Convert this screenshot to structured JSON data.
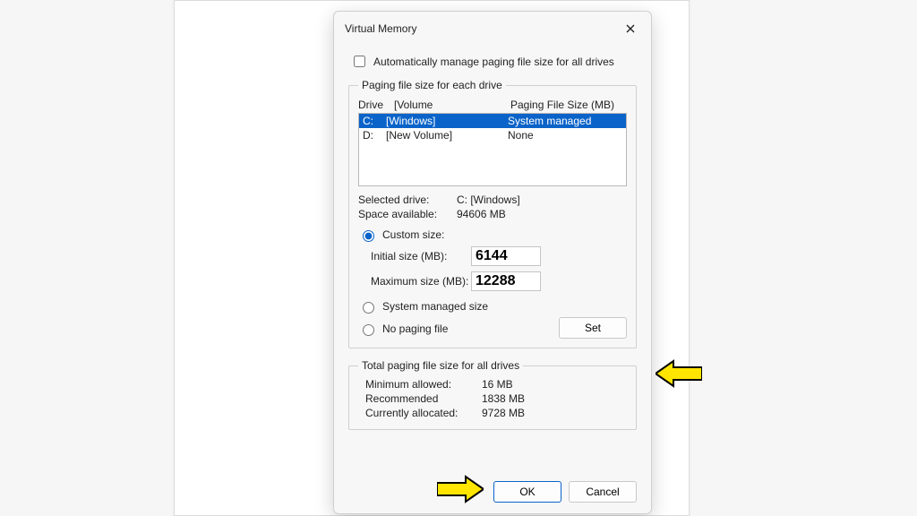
{
  "window": {
    "title": "Virtual Memory"
  },
  "auto": {
    "label": "Automatically manage paging file size for all drives"
  },
  "group1": {
    "legend": "Paging file size for each drive",
    "hdr_drive": "Drive",
    "hdr_volume": "[Volume",
    "hdr_size": "Paging File Size (MB)",
    "rows": [
      {
        "drive": "C:",
        "volume": "[Windows]",
        "size": "System managed"
      },
      {
        "drive": "D:",
        "volume": "[New Volume]",
        "size": "None"
      }
    ],
    "sel_label": "Selected drive:",
    "sel_value": "C:  [Windows]",
    "space_label": "Space available:",
    "space_value": "94606 MB",
    "custom_label": "Custom size:",
    "init_label": "Initial size (MB):",
    "init_value": "6144",
    "max_label": "Maximum size (MB):",
    "max_value": "12288",
    "sysman_label": "System managed size",
    "nopage_label": "No paging file",
    "set_label": "Set"
  },
  "group2": {
    "legend": "Total paging file size for all drives",
    "min_label": "Minimum allowed:",
    "min_value": "16 MB",
    "rec_label": "Recommended",
    "rec_value": "1838 MB",
    "cur_label": "Currently allocated:",
    "cur_value": "9728 MB"
  },
  "buttons": {
    "ok": "OK",
    "cancel": "Cancel"
  }
}
